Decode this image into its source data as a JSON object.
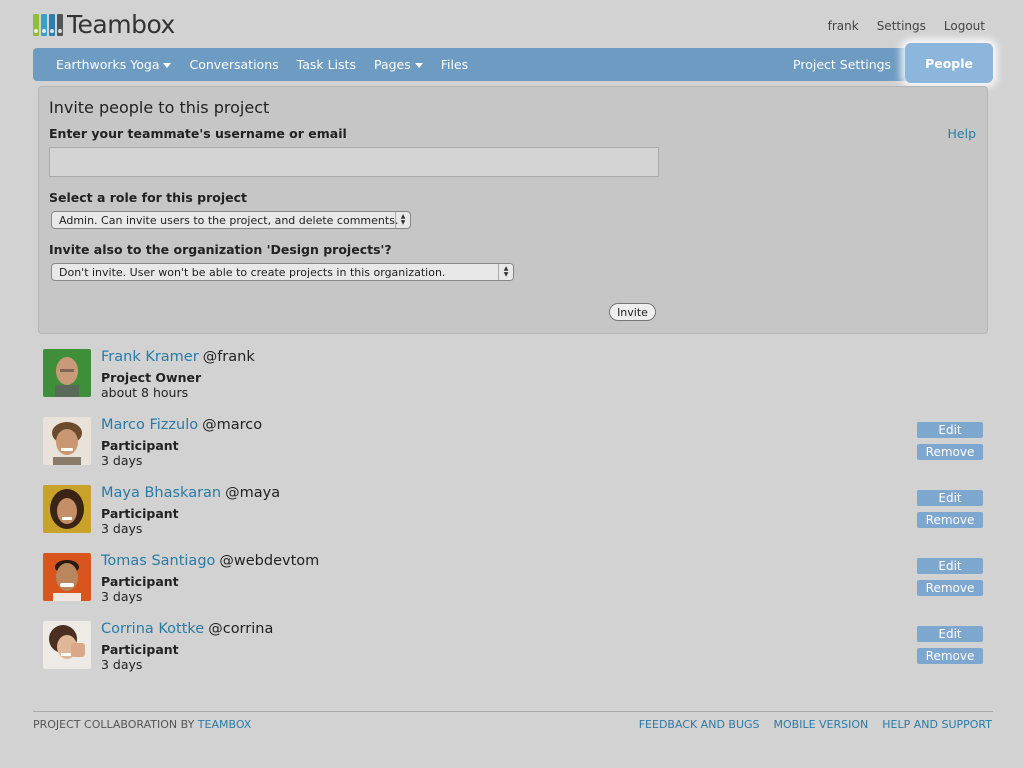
{
  "logo": {
    "text": "Teambox"
  },
  "user_menu": {
    "username": "frank",
    "settings": "Settings",
    "logout": "Logout"
  },
  "nav": {
    "project": "Earthworks Yoga",
    "conversations": "Conversations",
    "task_lists": "Task Lists",
    "pages": "Pages",
    "files": "Files",
    "project_settings": "Project Settings",
    "people": "People"
  },
  "invite": {
    "title": "Invite people to this project",
    "username_label": "Enter your teammate's username or email",
    "help": "Help",
    "username_value": "",
    "role_label": "Select a role for this project",
    "role_selected": "Admin. Can invite users to the project, and delete comments.",
    "org_label": "Invite also to the organization 'Design projects'?",
    "org_selected": "Don't invite. User won't be able to create projects in this organization.",
    "invite_button": "Invite"
  },
  "people": [
    {
      "name": "Frank Kramer",
      "handle": "@frank",
      "role": "Project Owner",
      "time": "about 8 hours",
      "editable": false
    },
    {
      "name": "Marco Fizzulo",
      "handle": "@marco",
      "role": "Participant",
      "time": "3 days",
      "editable": true
    },
    {
      "name": "Maya Bhaskaran",
      "handle": "@maya",
      "role": "Participant",
      "time": "3 days",
      "editable": true
    },
    {
      "name": "Tomas Santiago",
      "handle": "@webdevtom",
      "role": "Participant",
      "time": "3 days",
      "editable": true
    },
    {
      "name": "Corrina Kottke",
      "handle": "@corrina",
      "role": "Participant",
      "time": "3 days",
      "editable": true
    }
  ],
  "person_actions": {
    "edit": "Edit",
    "remove": "Remove"
  },
  "footer": {
    "left_prefix": "PROJECT COLLABORATION BY",
    "left_brand": "TEAMBOX",
    "feedback": "FEEDBACK AND BUGS",
    "mobile": "MOBILE VERSION",
    "help": "HELP AND SUPPORT"
  },
  "colors": {
    "nav_bar": "#6e9bc1",
    "nav_active": "#8db6dc",
    "link": "#2a7ba6",
    "action_button": "#7ea7cf"
  }
}
